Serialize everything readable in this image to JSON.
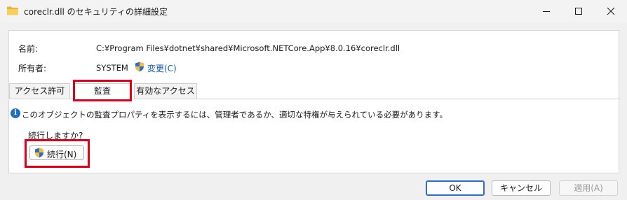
{
  "window": {
    "title": "coreclr.dll のセキュリティの詳細設定"
  },
  "details": {
    "name_label": "名前:",
    "name_value": "C:¥Program Files¥dotnet¥shared¥Microsoft.NETCore.App¥8.0.16¥coreclr.dll",
    "owner_label": "所有者:",
    "owner_value": "SYSTEM",
    "change_link": "変更(C)"
  },
  "tabs": [
    {
      "label": "アクセス許可",
      "selected": false
    },
    {
      "label": "監査",
      "selected": true
    },
    {
      "label": "有効なアクセス",
      "selected": false
    }
  ],
  "audit": {
    "info_message": "このオブジェクトの監査プロパティを表示するには、管理者であるか、適切な特権が与えられている必要があります。",
    "prompt": "続行しますか?",
    "continue_button": "続行(N)"
  },
  "buttons": {
    "ok": "OK",
    "cancel": "キャンセル",
    "apply": "適用(A)",
    "apply_enabled": false
  },
  "colors": {
    "highlight": "#e0001a",
    "link": "#0f5fb6",
    "info_icon": "#1f6fc5",
    "folder": "#f2c04a"
  },
  "icons": [
    "folder-icon",
    "minimize-icon",
    "maximize-icon",
    "close-icon",
    "uac-shield-icon",
    "info-icon"
  ]
}
